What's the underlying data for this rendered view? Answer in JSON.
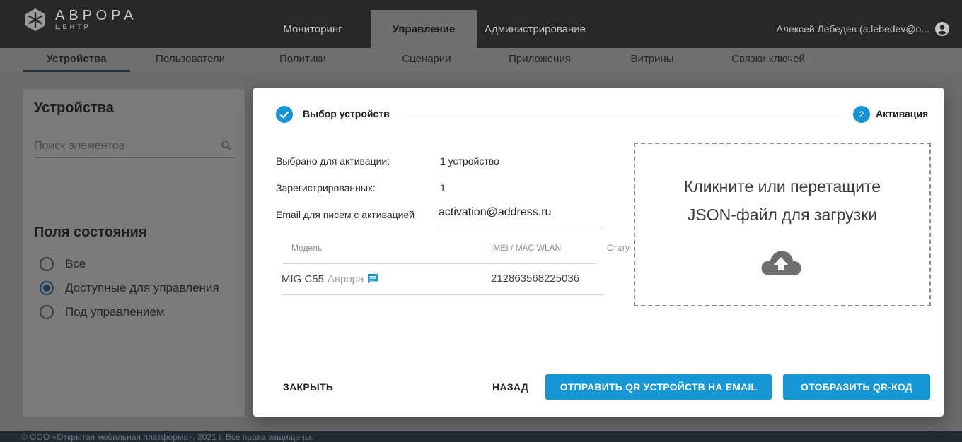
{
  "colors": {
    "accent": "#1597d6",
    "topbar": "#282828",
    "footer": "#1f2a33",
    "overlay": "#6e6e6e"
  },
  "logo": {
    "name": "АВРОРА",
    "sub": "ЦЕНТР"
  },
  "main_nav": [
    "Мониторинг",
    "Управление",
    "Администрирование"
  ],
  "user": {
    "name": "Алексей Лебедев (a.lebedev@o...",
    "icon": "account-circle-icon"
  },
  "sub_nav": [
    "Устройства",
    "Пользователи",
    "Политики",
    "Сценарии",
    "Приложения",
    "Витрины",
    "Связки ключей"
  ],
  "sidebar": {
    "title": "Устройства",
    "search_placeholder": "Поиск элементов",
    "status_title": "Поля состояния",
    "radios": [
      {
        "label": "Все",
        "checked": false
      },
      {
        "label": "Доступные для управления",
        "checked": true
      },
      {
        "label": "Под управлением",
        "checked": false
      }
    ]
  },
  "footer": {
    "text": "© ООО «Открытая мобильная платформа», 2021 г. Все права защищены."
  },
  "dialog": {
    "step1": "Выбор устройств",
    "step2_number": "2",
    "step2": "Активация",
    "selected_label": "Выбрано для активации:",
    "selected_value": "1 устройство",
    "registered_label": "Зарегистрированных:",
    "registered_value": "1",
    "email_label": "Email для писем с активацией",
    "email_value": "activation@address.ru",
    "table": {
      "headers": [
        "Модель",
        "IMEI / MAC WLAN",
        "Стату"
      ],
      "rows": [
        {
          "model": "MIG C55",
          "vendor": "Аврора",
          "imei": "212863568225036"
        }
      ]
    },
    "dropzone_line1": "Кликните или перетащите",
    "dropzone_line2": "JSON-файл для загрузки",
    "buttons": {
      "close": "ЗАКРЫТЬ",
      "back": "НАЗАД",
      "send_email": "ОТПРАВИТЬ QR УСТРОЙСТВ НА EMAIL",
      "show_qr": "ОТОБРАЗИТЬ QR-КОД"
    }
  }
}
